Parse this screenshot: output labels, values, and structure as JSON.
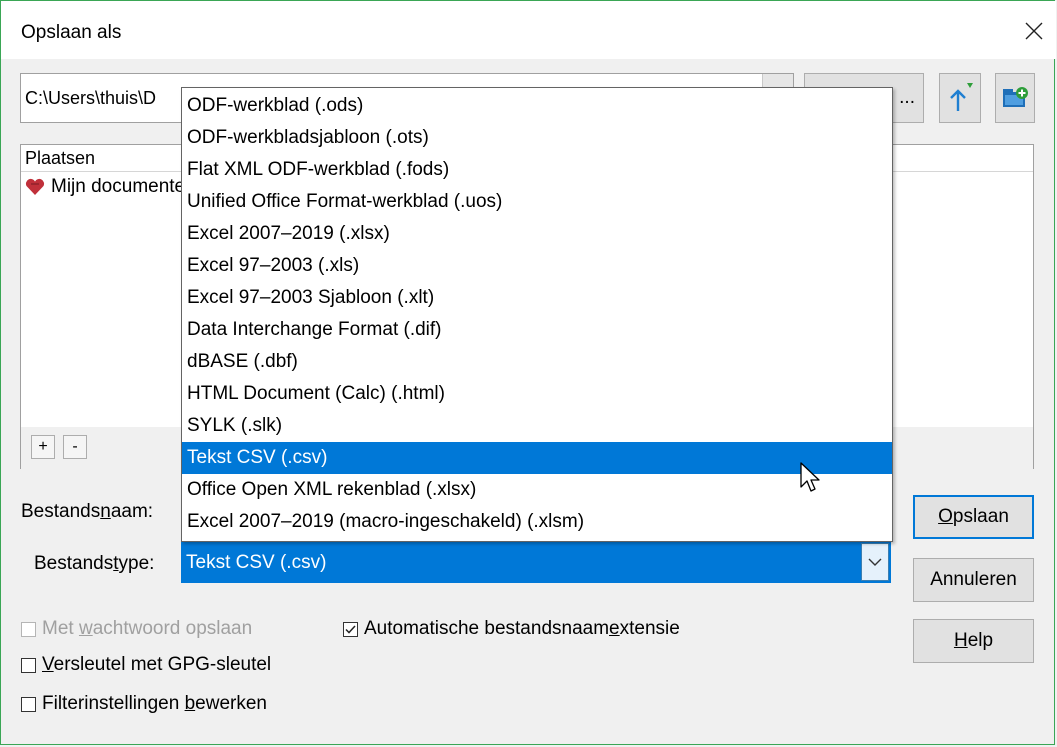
{
  "dialog": {
    "title": "Opslaan als",
    "path_value": "C:\\Users\\thuis\\D",
    "path_button_label": "...",
    "places_title": "Plaatsen",
    "places_item": "Mijn documenten",
    "add_label": "+",
    "remove_label": "-"
  },
  "form": {
    "filename_label_pre": "Bestands",
    "filename_label_u": "n",
    "filename_label_post": "aam:",
    "filetype_label_pre": "Bestands",
    "filetype_label_u": "t",
    "filetype_label_post": "ype:",
    "filetype_value": "Tekst CSV (.csv)"
  },
  "buttons": {
    "save_u": "O",
    "save_rest": "pslaan",
    "cancel": "Annuleren",
    "help_u": "H",
    "help_rest": "elp"
  },
  "options": {
    "password_pre": "Met ",
    "password_u": "w",
    "password_post": "achtwoord opslaan",
    "auto_ext_pre": "Automatische bestandsnaam",
    "auto_ext_u": "e",
    "auto_ext_post": "xtensie",
    "gpg_u": "V",
    "gpg_post": "ersleutel met GPG-sleutel",
    "filter_pre": "Filterinstellingen ",
    "filter_u": "b",
    "filter_post": "ewerken",
    "auto_ext_checked": true,
    "password_disabled": true
  },
  "dropdown": {
    "items": [
      "ODF-werkblad (.ods)",
      "ODF-werkbladsjabloon (.ots)",
      "Flat XML ODF-werkblad (.fods)",
      "Unified Office Format-werkblad (.uos)",
      "Excel 2007–2019 (.xlsx)",
      "Excel 97–2003 (.xls)",
      "Excel 97–2003 Sjabloon (.xlt)",
      "Data Interchange Format (.dif)",
      "dBASE (.dbf)",
      "HTML Document (Calc) (.html)",
      "SYLK (.slk)",
      "Tekst CSV (.csv)",
      "Office Open XML rekenblad (.xlsx)",
      "Excel 2007–2019 (macro-ingeschakeld) (.xlsm)"
    ],
    "selected_index": 11
  },
  "colors": {
    "accent": "#0078d7",
    "border_green": "#3aa655"
  }
}
